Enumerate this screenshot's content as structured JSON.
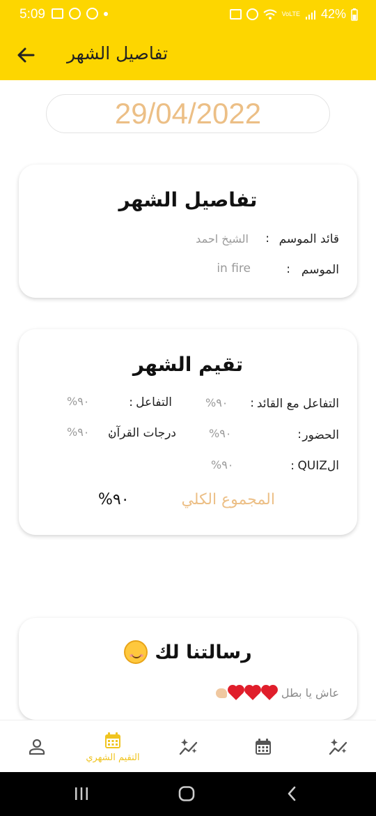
{
  "status_bar": {
    "time": "5:09",
    "network_label": "VoLTE",
    "battery": "42%"
  },
  "app_bar": {
    "title": "تفاصيل الشهر",
    "back_icon": "arrow-left-icon"
  },
  "date": "29/04/2022",
  "details_card": {
    "title": "تفاصيل الشهر",
    "rows": [
      {
        "label": "قائد الموسم",
        "separator": ":",
        "value": "الشيخ احمد"
      },
      {
        "label": "الموسم",
        "separator": ":",
        "value": "in fire"
      }
    ]
  },
  "rating_card": {
    "title": "تقيم الشهر",
    "items": [
      {
        "label": "التفاعل مع القائد",
        "separator": ":",
        "value": "%٩٠"
      },
      {
        "label": "التفاعل",
        "separator": ":",
        "value": "%٩٠"
      },
      {
        "label": "الحضور",
        "separator": ":",
        "value": "%٩٠"
      },
      {
        "label": "درجات القرآن",
        "separator": ":",
        "value": "%٩٠"
      },
      {
        "label": "الQUIZ",
        "separator": ":",
        "value": "%٩٠"
      }
    ],
    "total_label": "المجموع الكلي",
    "total_value": "%٩٠"
  },
  "message_card": {
    "title": "رسالتنا لك",
    "title_emoji": "smiling-face-icon",
    "text": "عاش يا بطل"
  },
  "bottom_nav": {
    "items": [
      {
        "icon": "person-icon",
        "label": ""
      },
      {
        "icon": "calendar-icon",
        "label": "التقيم الشهري",
        "active": true
      },
      {
        "icon": "sparkle-chart-icon",
        "label": ""
      },
      {
        "icon": "calendar-icon",
        "label": ""
      },
      {
        "icon": "sparkle-chart-icon",
        "label": ""
      }
    ]
  },
  "colors": {
    "primary": "#fdd600",
    "accent": "#ecbf86",
    "nav_active": "#f0c420"
  }
}
